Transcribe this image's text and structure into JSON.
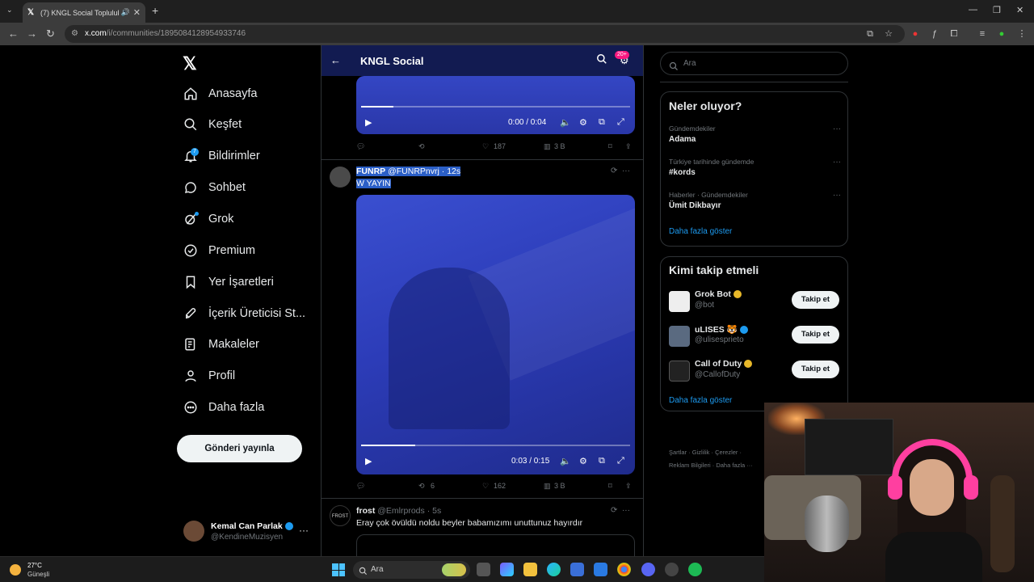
{
  "browser": {
    "tab_title": "(7) KNGL Social Topluluk / X",
    "url_host": "x.com",
    "url_path": "/i/communities/1895084128954933746"
  },
  "nav": {
    "items": [
      {
        "label": "Anasayfa",
        "icon": "home-icon"
      },
      {
        "label": "Keşfet",
        "icon": "search-icon"
      },
      {
        "label": "Bildirimler",
        "icon": "bell-icon"
      },
      {
        "label": "Sohbet",
        "icon": "chat-icon"
      },
      {
        "label": "Grok",
        "icon": "grok-icon"
      },
      {
        "label": "Premium",
        "icon": "premium-icon"
      },
      {
        "label": "Yer İşaretleri",
        "icon": "bookmark-icon"
      },
      {
        "label": "İçerik Üreticisi St...",
        "icon": "rocket-icon"
      },
      {
        "label": "Makaleler",
        "icon": "article-icon"
      },
      {
        "label": "Profil",
        "icon": "person-icon"
      },
      {
        "label": "Daha fazla",
        "icon": "more-circle-icon"
      }
    ],
    "notification_count": "7",
    "post_button": "Gönderi yayınla",
    "profile": {
      "name": "Kemal Can Parlak",
      "handle": "@KendineMuzisyen"
    }
  },
  "community": {
    "title": "KNGL Social",
    "badge": "20+"
  },
  "posts": [
    {
      "video_time": "0:00 / 0:04",
      "video_progress": 0.12,
      "replies": "",
      "reposts": "",
      "likes": "187",
      "views": "3 B"
    },
    {
      "author": "FUNRP",
      "handle": "@FUNRPnvrj",
      "time": "12s",
      "text": "W YAYIN",
      "video_time": "0:03 / 0:15",
      "video_progress": 0.2,
      "reposts": "6",
      "likes": "162",
      "views": "3 B"
    },
    {
      "author": "frost",
      "handle": "@Emlrprods",
      "time": "5s",
      "text": "Eray çok övüldü noldu beyler babamızımı unuttunuz hayırdır",
      "avatar_text": "FROST"
    }
  ],
  "right": {
    "search_placeholder": "Ara",
    "trends_title": "Neler oluyor?",
    "trends": [
      {
        "meta": "Gündemdekiler",
        "name": "Adama"
      },
      {
        "meta": "Türkiye tarihinde gündemde",
        "name": "#kords"
      },
      {
        "meta": "Haberler · Gündemdekiler",
        "name": "Ümit Dikbayır"
      }
    ],
    "show_more": "Daha fazla göster",
    "wtf_title": "Kimi takip etmeli",
    "wtf": [
      {
        "name": "Grok Bot",
        "handle": "@bot",
        "button": "Takip et"
      },
      {
        "name": "uLISES 🐯",
        "handle": "@ulisesprieto",
        "button": "Takip et"
      },
      {
        "name": "Call of Duty",
        "handle": "@CallofDuty",
        "button": "Takip et"
      }
    ],
    "footer_line1": "Şartlar  ·  Gizlilik  ·  Çerezler  ·",
    "footer_line2": "Reklam Bilgileri  ·  Daha fazla ···"
  },
  "taskbar": {
    "temp": "27°C",
    "condition": "Güneşli",
    "search": "Ara"
  }
}
